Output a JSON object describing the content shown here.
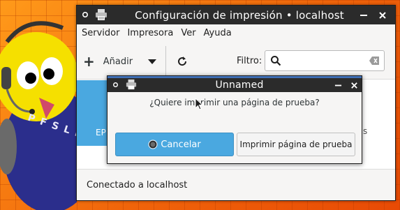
{
  "main_window": {
    "title": "Configuración de impresión • localhost",
    "menu": [
      "Servidor",
      "Impresora",
      "Ver",
      "Ayuda"
    ],
    "toolbar": {
      "add_label": "Añadir",
      "filter_label": "Filtro:",
      "filter_value": ""
    },
    "printer_tile_label": "EP",
    "right_partial_label": "s",
    "status": "Conectado a localhost"
  },
  "dialog": {
    "title": "Unnamed",
    "question": "¿Quiere imprimir una página de prueba?",
    "cancel_label": "Cancelar",
    "print_label": "Imprimir página de prueba"
  },
  "wallpaper": {
    "letters": "PFSLE"
  },
  "colors": {
    "accent": "#4aa8e0",
    "titlebar": "#2b2b2b",
    "wallpaper": "#f0640a"
  }
}
